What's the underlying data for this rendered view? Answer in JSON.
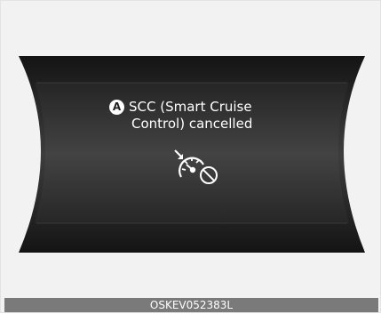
{
  "message": {
    "marker": "A",
    "line1": "SCC (Smart Cruise",
    "line2": "Control) cancelled"
  },
  "icon": "cruise-control-cancelled-icon",
  "image_code": "OSKEV052383L",
  "colors": {
    "page_background": "#f2f2f2",
    "display_dark": "#1b1b1b",
    "display_center": "#3c3c3c",
    "text": "#ffffff",
    "caption_bar": "#7a7a7a"
  }
}
